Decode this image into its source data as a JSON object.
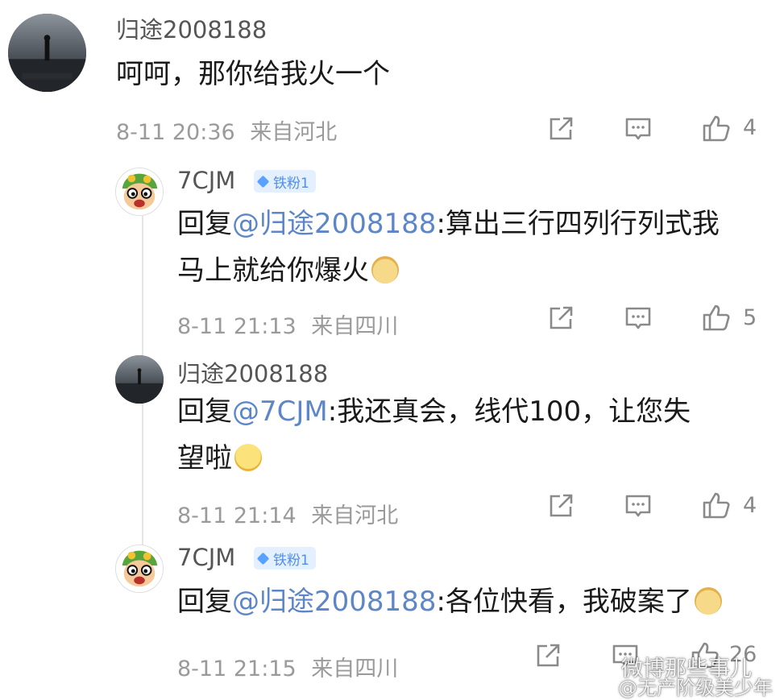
{
  "comments": [
    {
      "username": "归途2008188",
      "text": "呵呵，那你给我火一个",
      "time": "8-11 20:36",
      "location": "来自河北",
      "likes": "4"
    },
    {
      "username": "7CJM",
      "badge": "铁粉1",
      "reply_prefix": "回复",
      "mention": "@归途2008188",
      "text_line1": ":算出三行四列行列式我",
      "text_line2": "马上就给你爆火",
      "time": "8-11 21:13",
      "location": "来自四川",
      "likes": "5"
    },
    {
      "username": "归途2008188",
      "reply_prefix": "回复",
      "mention": "@7CJM",
      "text_line1": ":我还真会，线代100，让您失",
      "text_line2": "望啦",
      "time": "8-11 21:14",
      "location": "来自河北",
      "likes": "4"
    },
    {
      "username": "7CJM",
      "badge": "铁粉1",
      "reply_prefix": "回复",
      "mention": "@归途2008188",
      "text_line1": ":各位快看，我破案了",
      "time": "8-11 21:15",
      "location": "来自四川",
      "likes": "26"
    }
  ],
  "watermark": {
    "line1": "微博那些事儿",
    "line2": "@无产阶级美少年"
  },
  "colors": {
    "mention": "#5d86c8",
    "badge_bg": "#e4efff",
    "badge_text": "#4f8fe8",
    "meta": "#9a9a9a"
  },
  "icons": [
    "share-icon",
    "comment-icon",
    "like-icon",
    "dog-emoji",
    "grin-emoji"
  ]
}
